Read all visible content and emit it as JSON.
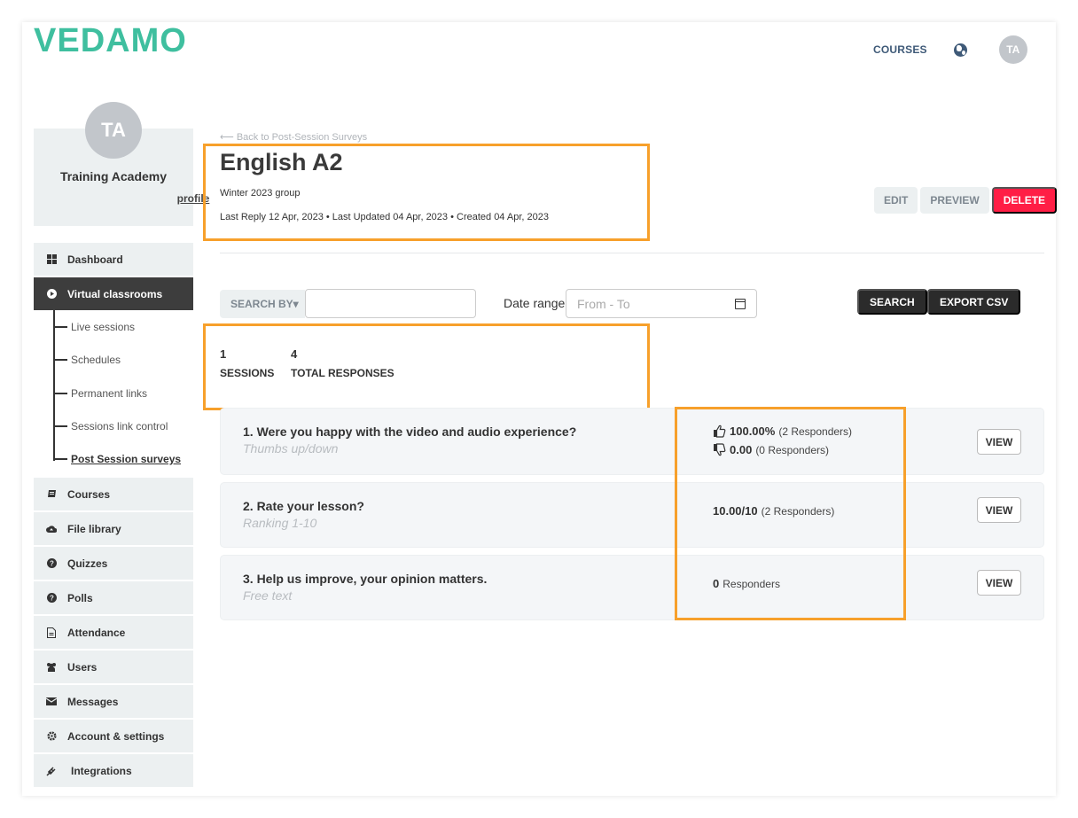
{
  "brand": {
    "logo_text": "VEDAMO",
    "logo_color": "#3fbf9f",
    "accent_orange": "#f7a02b",
    "delete_color": "#ff1e45"
  },
  "topnav": {
    "courses_label": "COURSES",
    "globe_icon": "globe-icon",
    "avatar_initials": "TA"
  },
  "profile": {
    "initials": "TA",
    "name": "Training Academy",
    "link_label": "profile"
  },
  "sidebar": {
    "items": [
      {
        "label": "Dashboard",
        "icon": "grid-icon"
      },
      {
        "label": "Virtual classrooms",
        "icon": "play-circle-icon",
        "active": true
      },
      {
        "label": "Courses",
        "icon": "book-icon"
      },
      {
        "label": "File library",
        "icon": "cloud-upload-icon"
      },
      {
        "label": "Quizzes",
        "icon": "question-circle-icon"
      },
      {
        "label": "Polls",
        "icon": "question-circle-icon"
      },
      {
        "label": "Attendance",
        "icon": "document-icon"
      },
      {
        "label": "Users",
        "icon": "users-icon"
      },
      {
        "label": "Messages",
        "icon": "envelope-icon"
      },
      {
        "label": "Account & settings",
        "icon": "gear-icon"
      },
      {
        "label": "Integrations",
        "icon": "plug-icon"
      }
    ],
    "subitems": [
      {
        "label": "Live sessions"
      },
      {
        "label": "Schedules"
      },
      {
        "label": "Permanent links"
      },
      {
        "label": "Sessions link control"
      },
      {
        "label": "Post Session surveys",
        "current": true
      }
    ]
  },
  "header": {
    "back_link": "⟵ Back to Post-Session Surveys",
    "title": "English A2",
    "subtitle": "Winter 2023 group",
    "meta": "Last Reply 12 Apr, 2023 • Last Updated 04 Apr, 2023 • Created 04 Apr, 2023",
    "edit_label": "EDIT",
    "preview_label": "PREVIEW",
    "delete_label": "DELETE"
  },
  "filters": {
    "search_by_label": "SEARCH BY▾",
    "search_value": "",
    "date_label": "Date range",
    "date_placeholder": "From - To",
    "search_button": "SEARCH",
    "export_button": "EXPORT CSV"
  },
  "stats": [
    {
      "value": "1",
      "label": "SESSIONS"
    },
    {
      "value": "4",
      "label": "TOTAL RESPONSES"
    }
  ],
  "questions": [
    {
      "title": "1. Were you happy with the video and audio experience?",
      "type": "Thumbs up/down",
      "up_value": "100.00%",
      "up_responders": "(2 Responders)",
      "down_value": "0.00",
      "down_responders": "(0 Responders)",
      "view_label": "VIEW"
    },
    {
      "title": "2. Rate your lesson?",
      "type": "Ranking 1-10",
      "value": "10.00/10",
      "responders": "(2 Responders)",
      "view_label": "VIEW"
    },
    {
      "title": "3. Help us improve, your opinion matters.",
      "type": "Free text",
      "value": "0",
      "responders": "Responders",
      "view_label": "VIEW"
    }
  ]
}
